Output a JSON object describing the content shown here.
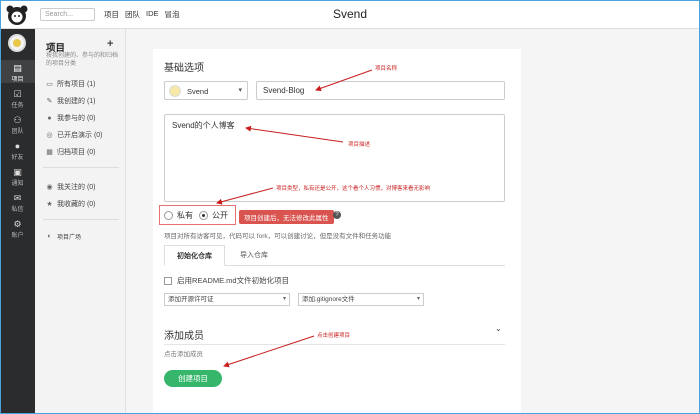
{
  "topbar": {
    "search_placeholder": "Search...",
    "nav": [
      "项目",
      "团队",
      "IDE",
      "冒泡"
    ],
    "title": "Svend"
  },
  "rail": {
    "items": [
      {
        "label": "项目",
        "icon": "project-icon",
        "active": true
      },
      {
        "label": "任务",
        "icon": "tasks-icon",
        "active": false
      },
      {
        "label": "团队",
        "icon": "team-icon",
        "active": false
      },
      {
        "label": "好友",
        "icon": "friends-icon",
        "active": false
      },
      {
        "label": "通知",
        "icon": "notification-icon",
        "active": false
      },
      {
        "label": "私信",
        "icon": "message-icon",
        "active": false
      },
      {
        "label": "账户",
        "icon": "account-icon",
        "active": false
      }
    ]
  },
  "sidebar": {
    "title": "项目",
    "subtitle": "按我创建的、参与的和归档的项目分类",
    "items": [
      {
        "label": "所有项目 (1)",
        "icon": "folder-icon"
      },
      {
        "label": "我创建的 (1)",
        "icon": "edit-icon"
      },
      {
        "label": "我参与的 (0)",
        "icon": "user-icon"
      },
      {
        "label": "已开启演示 (0)",
        "icon": "demo-icon"
      },
      {
        "label": "归档项目 (0)",
        "icon": "archive-icon"
      }
    ],
    "items2": [
      {
        "label": "我关注的 (0)",
        "icon": "eye-icon"
      },
      {
        "label": "我收藏的 (0)",
        "icon": "star-icon"
      }
    ],
    "plaza": "项目广场"
  },
  "form": {
    "basic_heading": "基础选项",
    "owner_name": "Svend",
    "project_name": "Svend-Blog",
    "description": "Svend的个人博客",
    "visibility": {
      "private_label": "私有",
      "public_label": "公开",
      "selected": "公开"
    },
    "warning": "项目创建后，无法修改此属性",
    "help": "?",
    "visibility_note": "项目对所有访客可见，代码可以 fork，可以创建讨论，但是没有文件和任务功能",
    "tabs": [
      "初始化仓库",
      "导入仓库"
    ],
    "readme_label": "启用README.md文件初始化项目",
    "license_select": "添加开源许可证",
    "gitignore_select": "添加.gitignore文件",
    "members_heading": "添加成员",
    "members_hint": "点击添加成员",
    "create_button": "创建项目"
  },
  "annotations": {
    "name": "项目名称",
    "desc": "项目描述",
    "type": "项目类型，私有还是公开，这个看个人习惯，对博客来看无影响",
    "create": "点击创建项目",
    "color": "#c81e1e"
  }
}
